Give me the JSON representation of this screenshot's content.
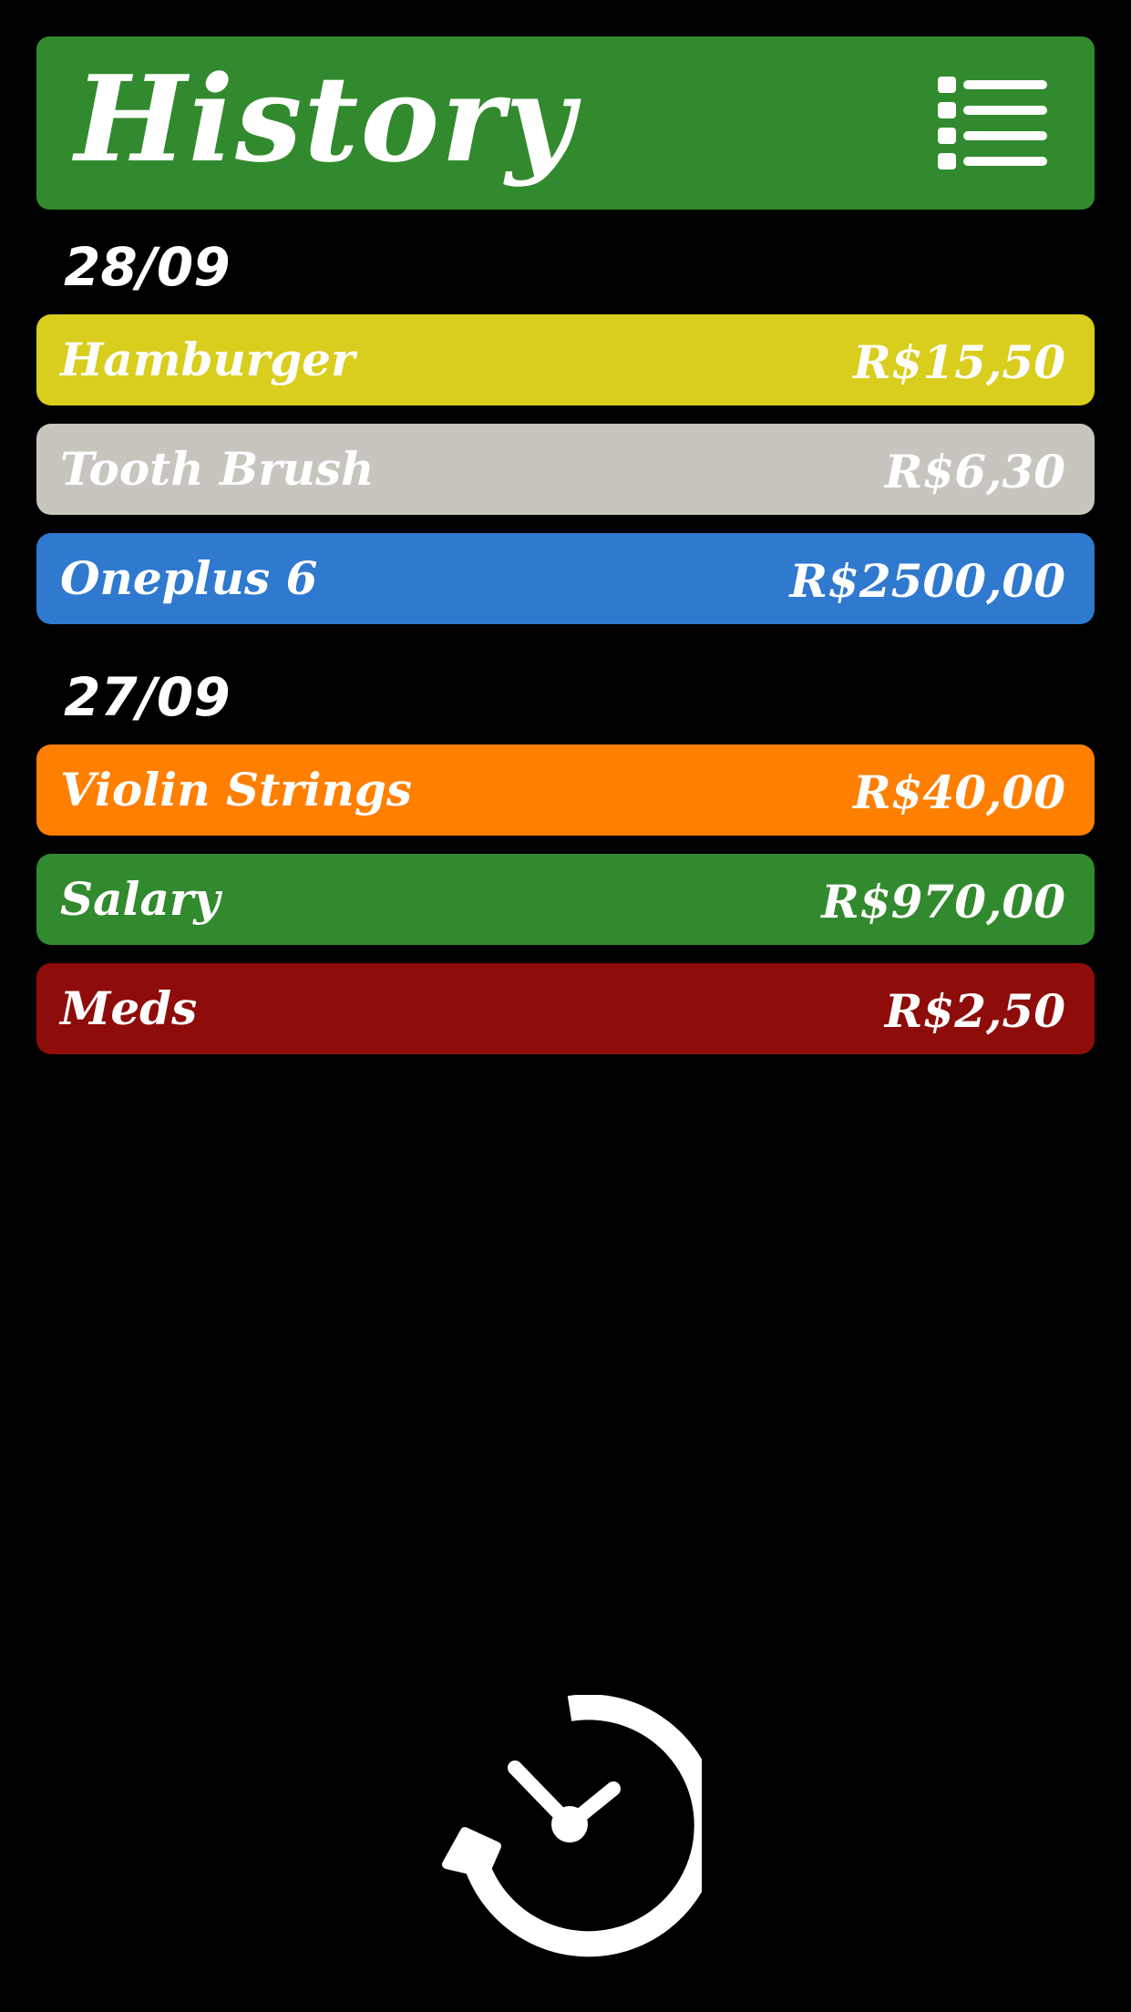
{
  "header": {
    "title": "History",
    "menu_icon": "list-menu-icon"
  },
  "groups": [
    {
      "date": "28/09",
      "items": [
        {
          "name": "Hamburger",
          "amount": "R$15,50",
          "color": "#d9cd1d"
        },
        {
          "name": "Tooth Brush",
          "amount": "R$6,30",
          "color": "#c7c5be"
        },
        {
          "name": "Oneplus 6",
          "amount": "R$2500,00",
          "color": "#2f79cf"
        }
      ]
    },
    {
      "date": "27/09",
      "items": [
        {
          "name": "Violin Strings",
          "amount": "R$40,00",
          "color": "#ff7f00"
        },
        {
          "name": "Salary",
          "amount": "R$970,00",
          "color": "#328a2e"
        },
        {
          "name": "Meds",
          "amount": "R$2,50",
          "color": "#8e0d0b"
        }
      ]
    }
  ],
  "fab": {
    "icon": "history-clock-icon"
  },
  "colors": {
    "background": "#000000",
    "header": "#328a2e",
    "text": "#ffffff"
  }
}
